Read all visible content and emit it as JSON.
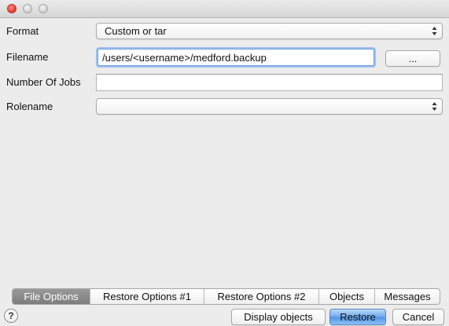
{
  "window": {
    "traffic_lights": [
      "close",
      "minimize",
      "maximize"
    ]
  },
  "form": {
    "format": {
      "label": "Format",
      "value": "Custom or tar"
    },
    "filename": {
      "label": "Filename",
      "value": "/users/<username>/medford.backup",
      "browse_label": "..."
    },
    "jobs": {
      "label": "Number Of Jobs",
      "value": ""
    },
    "rolename": {
      "label": "Rolename",
      "value": ""
    }
  },
  "tabs": [
    {
      "label": "File Options",
      "active": true
    },
    {
      "label": "Restore Options #1",
      "active": false
    },
    {
      "label": "Restore Options #2",
      "active": false
    },
    {
      "label": "Objects",
      "active": false
    },
    {
      "label": "Messages",
      "active": false
    }
  ],
  "footer": {
    "help_label": "?",
    "display_objects_label": "Display objects",
    "restore_label": "Restore",
    "cancel_label": "Cancel"
  },
  "colors": {
    "accent": "#4f93e6",
    "active_tab": "#7d7d7d",
    "close_light": "#e0443e"
  }
}
